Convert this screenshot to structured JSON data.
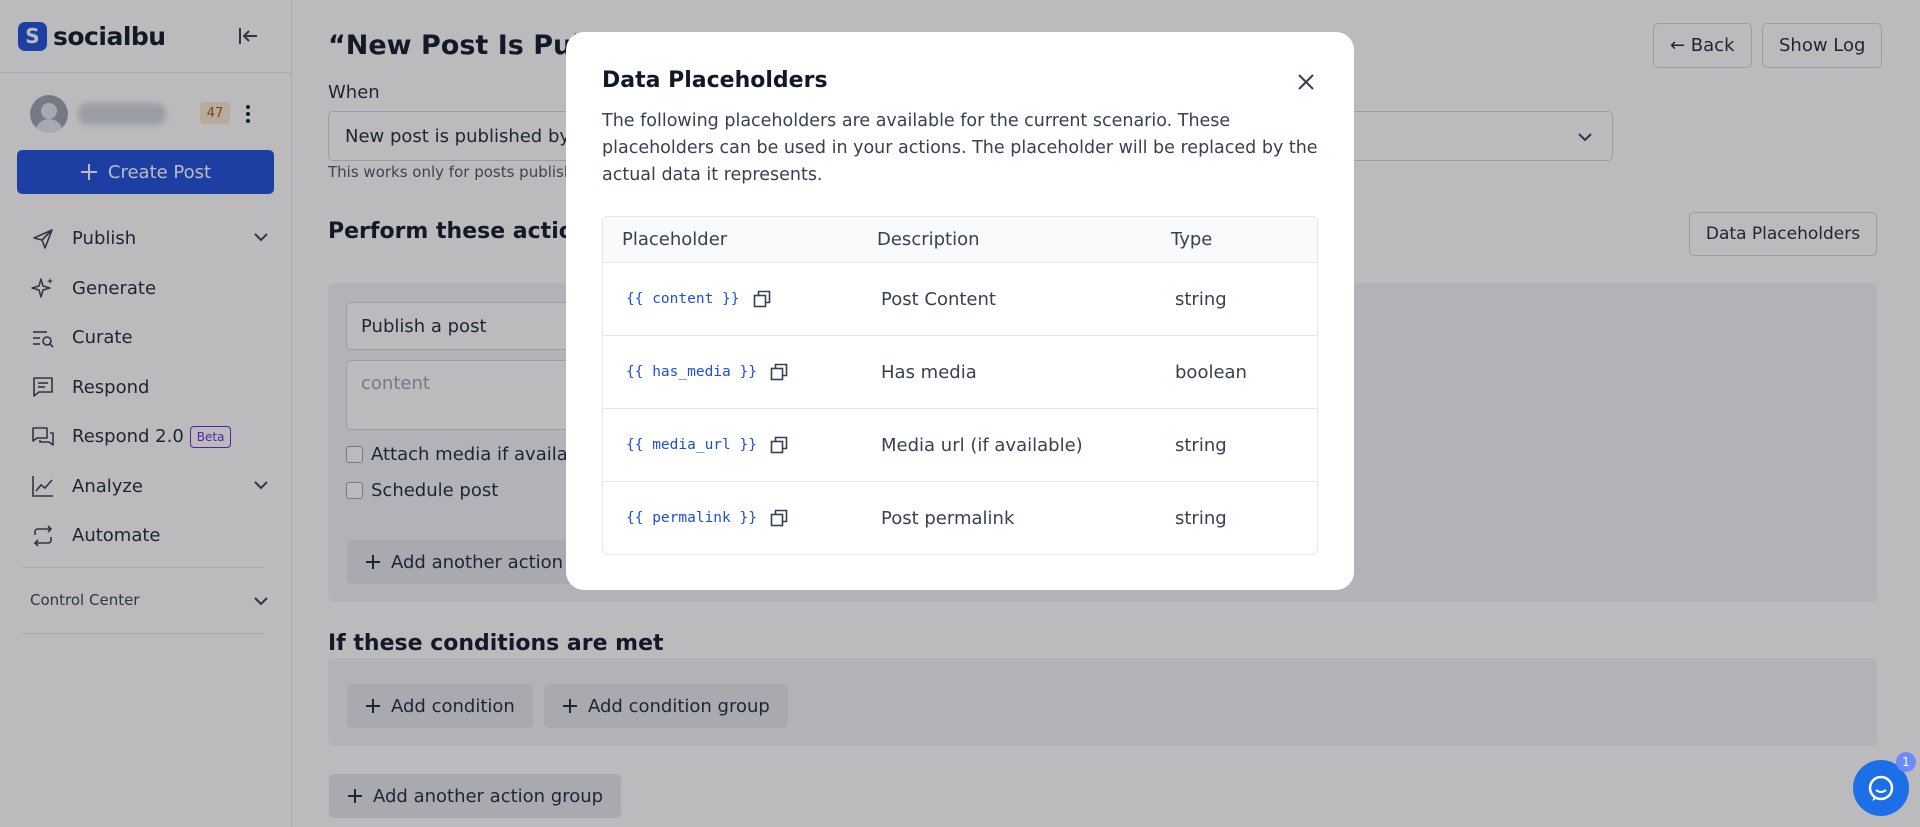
{
  "sidebar": {
    "logo_text": "socialbu",
    "notification_count": "47",
    "create_post_label": "Create Post",
    "items": [
      {
        "label": "Publish",
        "has_chevron": true
      },
      {
        "label": "Generate"
      },
      {
        "label": "Curate"
      },
      {
        "label": "Respond"
      },
      {
        "label": "Respond 2.0",
        "badge": "Beta"
      },
      {
        "label": "Analyze",
        "has_chevron": true
      },
      {
        "label": "Automate"
      }
    ],
    "control_center_label": "Control Center"
  },
  "header": {
    "title": "“New Post Is Publis",
    "back_label": "← Back",
    "show_log_label": "Show Log"
  },
  "trigger": {
    "label": "When",
    "value": "New post is published by a",
    "helper": "This works only for posts publishe"
  },
  "actions": {
    "title": "Perform these actions",
    "data_placeholders_button": "Data Placeholders",
    "action_type": "Publish a post",
    "content_placeholder": "content",
    "attach_media_label": "Attach media if availabl",
    "schedule_post_label": "Schedule post",
    "add_action_label": "Add another action"
  },
  "conditions": {
    "title": "If these conditions are met",
    "add_condition_label": "Add condition",
    "add_condition_group_label": "Add condition group"
  },
  "add_action_group_label": "Add another action group",
  "chat": {
    "unread": "1"
  },
  "modal": {
    "title": "Data Placeholders",
    "description": "The following placeholders are available for the current scenario. These placeholders can be used in your actions. The placeholder will be replaced by the actual data it represents.",
    "columns": [
      "Placeholder",
      "Description",
      "Type"
    ],
    "rows": [
      {
        "placeholder": "{{ content }}",
        "description": "Post Content",
        "type": "string"
      },
      {
        "placeholder": "{{ has_media }}",
        "description": "Has media",
        "type": "boolean"
      },
      {
        "placeholder": "{{ media_url }}",
        "description": "Media url (if available)",
        "type": "string"
      },
      {
        "placeholder": "{{ permalink }}",
        "description": "Post permalink",
        "type": "string"
      }
    ]
  },
  "colors": {
    "primary": "#1d4ed8",
    "overlay": "rgba(30,30,40,0.3)",
    "placeholder_code": "#1d4ed8",
    "beta": "#6d28d9",
    "badge_bg": "#fde8cf"
  }
}
